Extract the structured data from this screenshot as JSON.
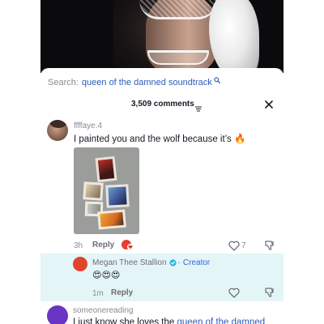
{
  "search": {
    "prefix": "Search:",
    "query": "queen of the damned soundtrack"
  },
  "comments_header": {
    "count_label": "3,509 comments"
  },
  "comments": [
    {
      "username": "ffffaye.4",
      "text": "I painted you and the wolf because it’s 🔥",
      "time": "3h",
      "reply_label": "Reply",
      "like_count": "7"
    }
  ],
  "creator_reply": {
    "username": "Megan Thee Stallion",
    "badge": "Creator",
    "text": "😍😍😍",
    "time": "1m",
    "reply_label": "Reply"
  },
  "third_comment": {
    "username": "someonereading",
    "text_prefix": "I just know she loves the ",
    "text_link": "queen of the damned"
  },
  "colors": {
    "link": "#2b5db8",
    "creator_blue": "#2c6ad6",
    "reply_highlight": "#e4f5f8",
    "creator_avatar": "#e0442d",
    "third_avatar": "#6a35c4"
  },
  "icons": {
    "search": "search-icon",
    "sort": "sort-icon",
    "close": "close-icon",
    "like": "heart-outline-icon",
    "dislike": "thumbs-down-icon",
    "verified": "verified-badge-icon",
    "creator_liked": "creator-liked-badge-icon"
  }
}
